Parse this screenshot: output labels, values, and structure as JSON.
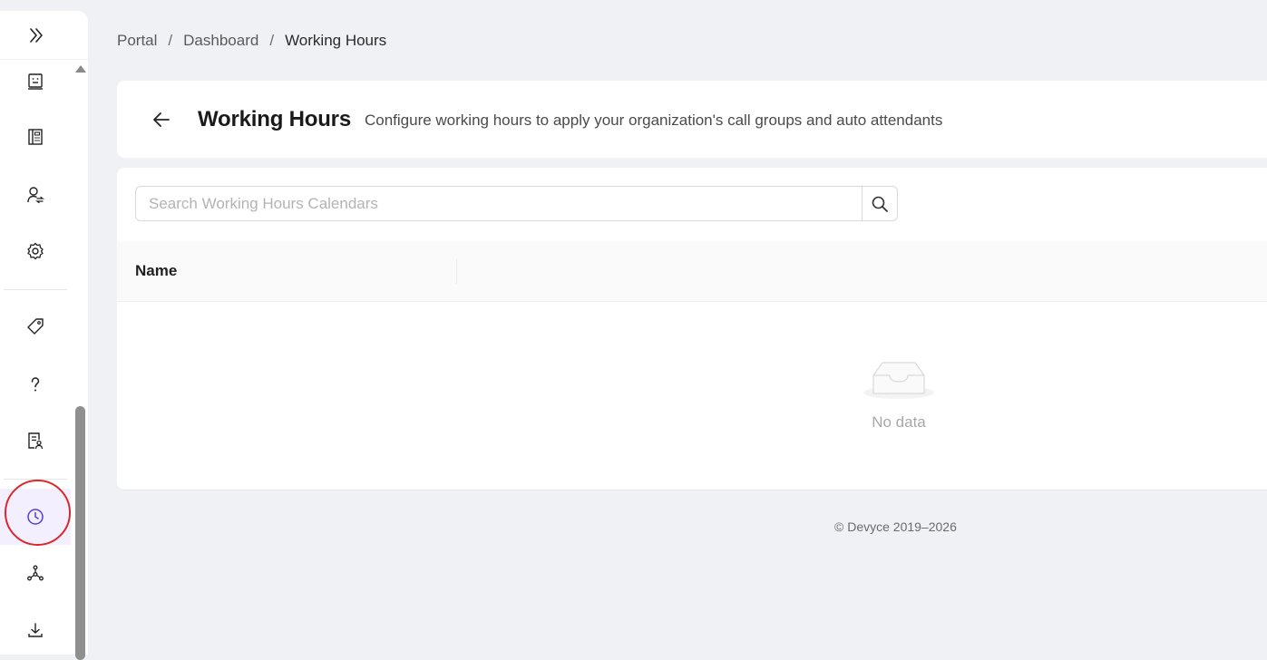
{
  "sidebar": {
    "items": [
      {
        "name": "badge-icon"
      },
      {
        "name": "phonebook-icon"
      },
      {
        "name": "user-switch-icon"
      },
      {
        "name": "settings-gear-icon"
      },
      {
        "name": "tag-icon"
      },
      {
        "name": "question-icon"
      },
      {
        "name": "user-report-icon"
      },
      {
        "name": "clock-icon",
        "active": true
      },
      {
        "name": "network-icon"
      },
      {
        "name": "download-icon"
      }
    ],
    "accent_color": "#5b3bd6",
    "highlight_color": "#d9292b"
  },
  "breadcrumb": {
    "items": [
      "Portal",
      "Dashboard",
      "Working Hours"
    ],
    "separator": "/"
  },
  "header": {
    "title": "Working Hours",
    "description": "Configure working hours to apply your organization's call groups and auto attendants"
  },
  "search": {
    "placeholder": "Search Working Hours Calendars",
    "value": ""
  },
  "table": {
    "columns": [
      "Name"
    ],
    "rows": [],
    "empty_text": "No data"
  },
  "footer": {
    "copyright": "© Devyce 2019–2026"
  }
}
